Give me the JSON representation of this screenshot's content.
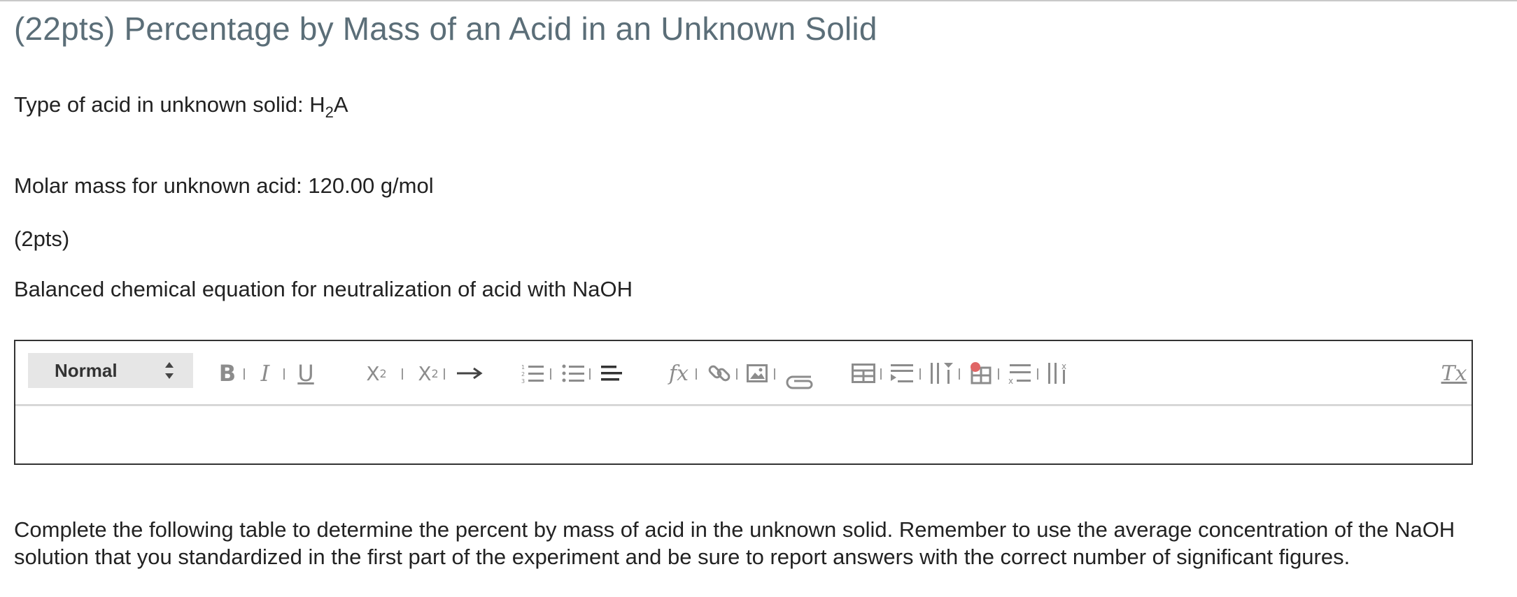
{
  "title": "(22pts) Percentage by Mass of an Acid in an Unknown Solid",
  "acid_type": {
    "label": "Type of acid in unknown solid: ",
    "formula_pre": "H",
    "formula_sub": "2",
    "formula_post": "A"
  },
  "molar_mass": "Molar mass for unknown acid: 120.00 g/mol",
  "points": "(2pts)",
  "balanced_prompt": "Balanced chemical equation for neutralization of acid with NaOH",
  "editor": {
    "format_select_value": "Normal",
    "toolbar_icons": [
      "bold-icon",
      "italic-icon",
      "underline-icon",
      "subscript-icon",
      "superscript-icon",
      "arrow-icon",
      "ordered-list-icon",
      "bullet-list-icon",
      "align-icon",
      "formula-icon",
      "link-icon",
      "image-icon",
      "attachment-icon",
      "table-icon",
      "table-insert-row-icon",
      "table-insert-column-icon",
      "table-delete-icon",
      "table-delete-row-icon",
      "table-delete-column-icon",
      "clear-formatting-icon"
    ],
    "labels": {
      "bold": "B",
      "italic": "I",
      "underline": "U",
      "subscript": "X",
      "subscript_mark": "2",
      "superscript": "X",
      "superscript_mark": "2",
      "formula": "fx",
      "clear": "Tx"
    },
    "content": ""
  },
  "instructions": "Complete the following table to determine the percent by mass of acid in the unknown solid. Remember to use the average concentration of the NaOH solution that you standardized in the first part of the experiment and be sure to report answers with the correct number of significant figures.",
  "colors": {
    "title": "#5b6e78",
    "toolbar_icon": "#8c8c8c",
    "select_bg": "#e6e6e6",
    "delete_accent": "#e06666"
  }
}
